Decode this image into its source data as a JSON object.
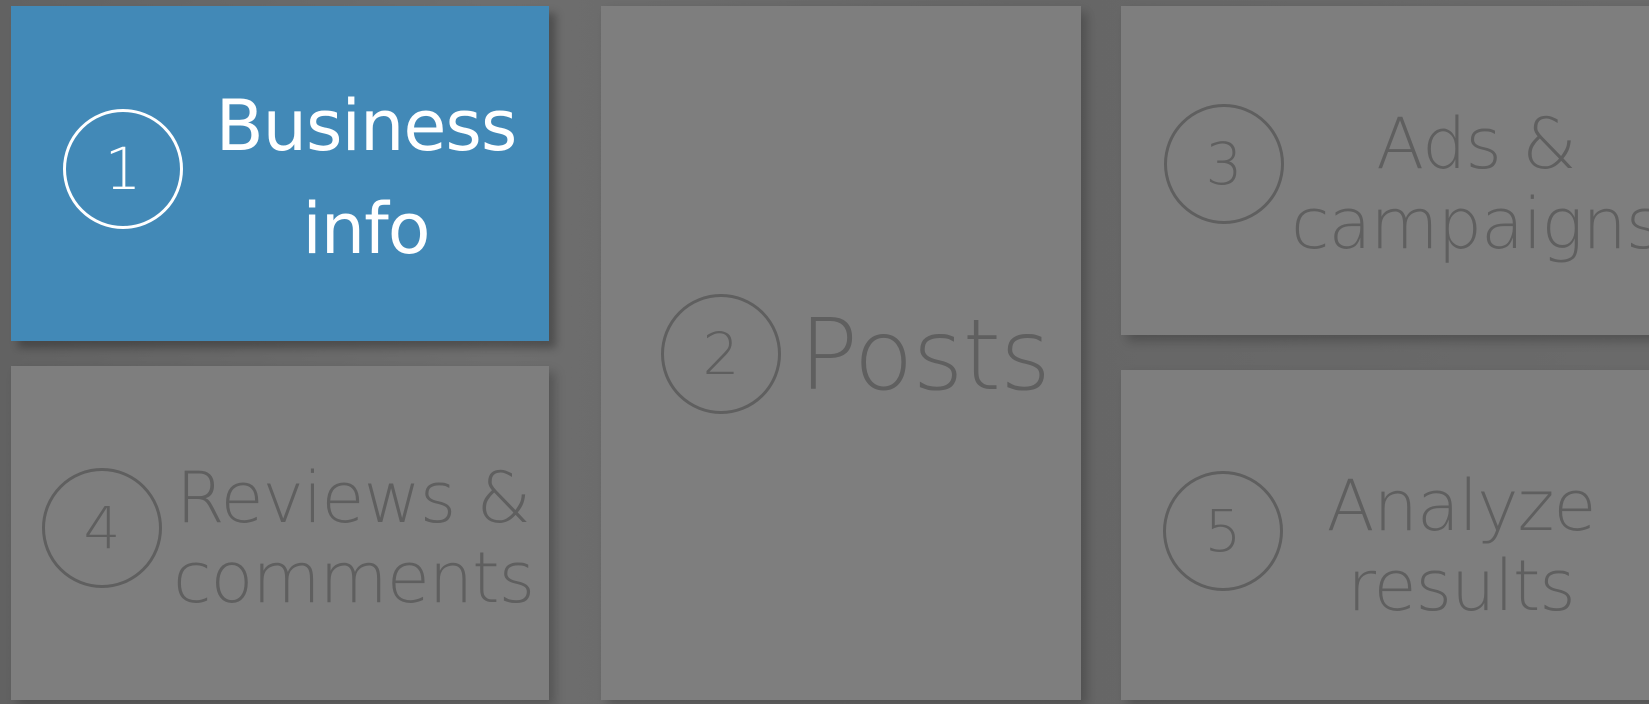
{
  "tiles": [
    {
      "number": "1",
      "label_line1": "Business",
      "label_line2": "info",
      "active": true
    },
    {
      "number": "2",
      "label_line1": "Posts",
      "active": false
    },
    {
      "number": "3",
      "label_line1": "Ads &",
      "label_line2": "campaigns",
      "active": false
    },
    {
      "number": "4",
      "label_line1": "Reviews &",
      "label_line2": "comments",
      "active": false
    },
    {
      "number": "5",
      "label_line1": "Analyze",
      "label_line2": "results",
      "active": false
    }
  ],
  "colors": {
    "active_tile": "#4289b7",
    "inactive_tile": "#7e7e7e",
    "inactive_text": "#5f5f5f",
    "active_text": "#ffffff",
    "background": "#666666"
  }
}
